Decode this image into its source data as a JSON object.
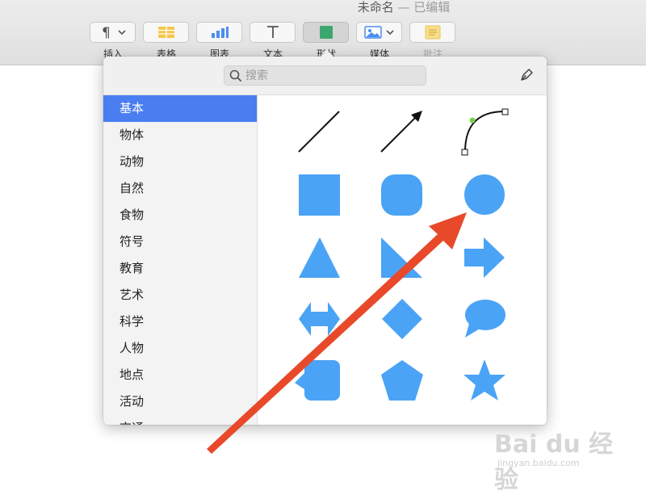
{
  "window": {
    "title": "未命名",
    "status": "— 已编辑"
  },
  "toolbar": {
    "buttons": [
      {
        "label": "插入",
        "icon": "paragraph-icon"
      },
      {
        "label": "表格",
        "icon": "table-icon"
      },
      {
        "label": "图表",
        "icon": "chart-icon"
      },
      {
        "label": "文本",
        "icon": "text-icon"
      },
      {
        "label": "形状",
        "icon": "shape-icon"
      },
      {
        "label": "媒体",
        "icon": "media-icon"
      },
      {
        "label": "批注",
        "icon": "comment-icon"
      }
    ]
  },
  "popover": {
    "search": {
      "placeholder": "搜索",
      "value": ""
    },
    "categories": [
      "基本",
      "物体",
      "动物",
      "自然",
      "食物",
      "符号",
      "教育",
      "艺术",
      "科学",
      "人物",
      "地点",
      "活动",
      "交通"
    ],
    "selected_category": "基本",
    "shapes": [
      "line",
      "arrow-line",
      "curve",
      "square",
      "rounded-square",
      "circle",
      "triangle",
      "right-triangle",
      "arrow-right",
      "double-arrow",
      "diamond",
      "speech-bubble",
      "callout-square",
      "pentagon",
      "star"
    ]
  },
  "colors": {
    "shape_fill": "#4aa3f5",
    "selection": "#4a7ef0",
    "annotation_arrow": "#e8492a"
  },
  "watermark": {
    "text": "Bai du 经验",
    "sub": "jingyan.baidu.com"
  }
}
